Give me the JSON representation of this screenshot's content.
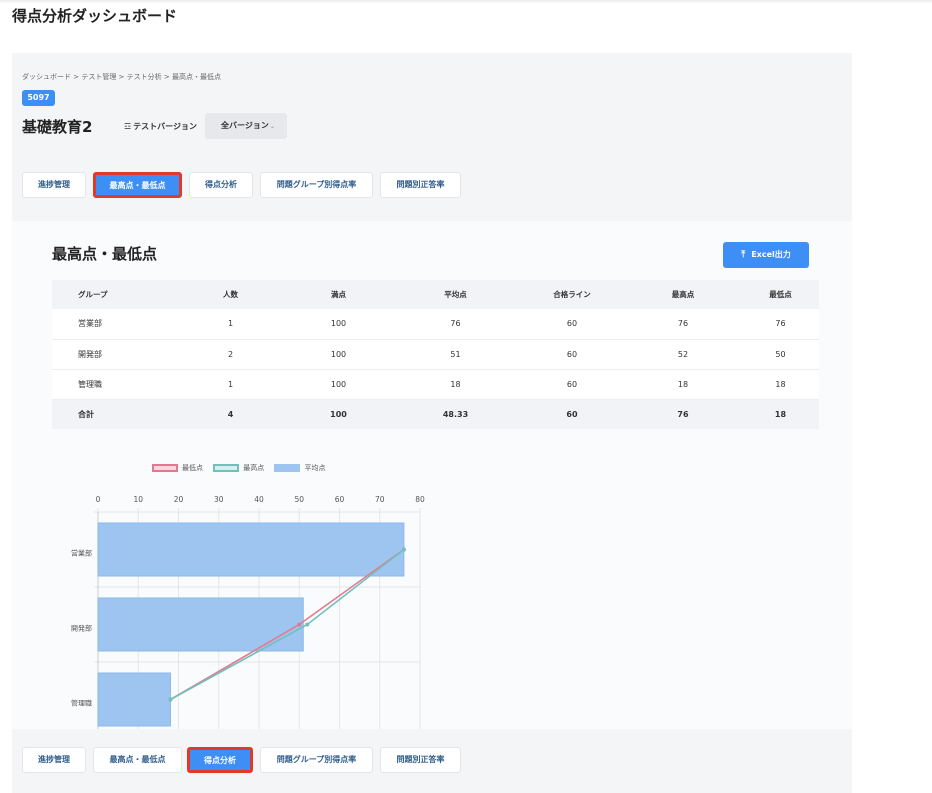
{
  "page_title": "得点分析ダッシュボード",
  "breadcrumb": "ダッシュボード > テスト管理 > テスト分析 > 最高点・最低点",
  "course_id": "5097",
  "course_name": "基礎教育2",
  "version": {
    "label": "テストバージョン",
    "selected": "全バージョン"
  },
  "tabs_top": [
    "進捗管理",
    "最高点・最低点",
    "得点分析",
    "問題グループ別得点率",
    "問題別正答率"
  ],
  "tabs_bottom": [
    "進捗管理",
    "最高点・最低点",
    "得点分析",
    "問題グループ別得点率",
    "問題別正答率"
  ],
  "active_tab_top": "最高点・最低点",
  "active_tab_bottom": "得点分析",
  "section_title": "最高点・最低点",
  "export_button": "Excel出力",
  "table": {
    "headers": [
      "グループ",
      "人数",
      "満点",
      "平均点",
      "合格ライン",
      "最高点",
      "最低点"
    ],
    "rows": [
      [
        "営業部",
        "1",
        "100",
        "76",
        "60",
        "76",
        "76"
      ],
      [
        "開発部",
        "2",
        "100",
        "51",
        "60",
        "52",
        "50"
      ],
      [
        "管理職",
        "1",
        "100",
        "18",
        "60",
        "18",
        "18"
      ]
    ],
    "total": [
      "合計",
      "4",
      "100",
      "48.33",
      "60",
      "76",
      "18"
    ]
  },
  "colors": {
    "accent": "#3d8ef5",
    "highlight_border": "#e03a2a",
    "min_line": "#e57890",
    "max_line": "#6fc1bd",
    "avg_bar": "#9ec5f0"
  },
  "chart_data": {
    "type": "bar",
    "orientation": "horizontal",
    "categories": [
      "営業部",
      "開発部",
      "管理職"
    ],
    "series": [
      {
        "name": "最低点",
        "kind": "line",
        "values": [
          76,
          50,
          18
        ],
        "color": "#e57890"
      },
      {
        "name": "最高点",
        "kind": "line",
        "values": [
          76,
          52,
          18
        ],
        "color": "#6fc1bd"
      },
      {
        "name": "平均点",
        "kind": "bar",
        "values": [
          76,
          51,
          18
        ],
        "color": "#9ec5f0"
      }
    ],
    "xlim": [
      0,
      80
    ],
    "xticks": [
      0,
      10,
      20,
      30,
      40,
      50,
      60,
      70,
      80
    ],
    "grid": true,
    "legend": "top"
  }
}
